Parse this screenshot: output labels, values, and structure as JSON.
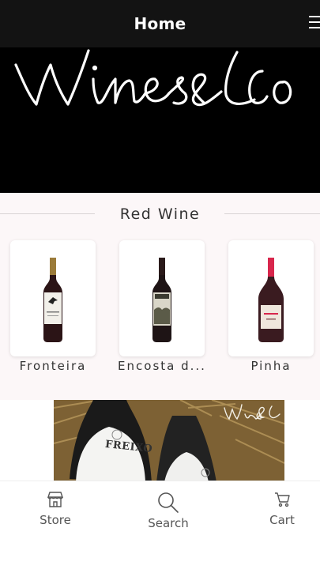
{
  "header": {
    "title": "Home",
    "menu_icon": "hamburger-menu-icon"
  },
  "hero": {
    "brand_logo": "Wines&Co",
    "background": "#000000"
  },
  "red_wine_section": {
    "title": "Red Wine",
    "products": [
      {
        "name": "Fronteira",
        "cap_color": "#9b7b3a"
      },
      {
        "name": "Encosta d...",
        "cap_color": "#2a1a1a"
      },
      {
        "name": "Pinha",
        "cap_color": "#d8264c"
      }
    ]
  },
  "promo_banner": {
    "bottle_label": "FREIXO",
    "logo": "Wines&Co"
  },
  "bottom_nav": {
    "items": [
      {
        "label": "Store",
        "icon": "store-icon"
      },
      {
        "label": "Search",
        "icon": "search-icon"
      },
      {
        "label": "Cart",
        "icon": "cart-icon"
      }
    ]
  }
}
